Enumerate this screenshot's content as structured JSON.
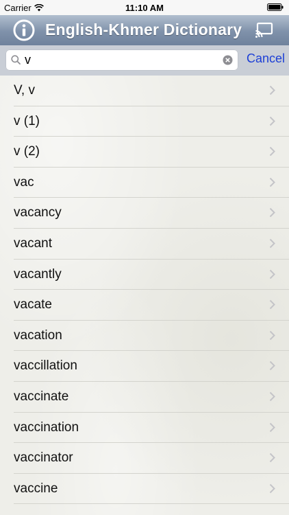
{
  "status_bar": {
    "carrier": "Carrier",
    "time": "11:10 AM",
    "icons": [
      "wifi-icon",
      "battery-icon"
    ]
  },
  "title_bar": {
    "title": "English-Khmer Dictionary",
    "icons": [
      "info-icon",
      "cast-icon"
    ],
    "color": "#7f91aa"
  },
  "search": {
    "value": "v",
    "placeholder": "",
    "cancel_label": "Cancel",
    "cancel_color": "#1c3fd6"
  },
  "words": [
    "V, v",
    "v (1)",
    "v (2)",
    "vac",
    "vacancy",
    "vacant",
    "vacantly",
    "vacate",
    "vacation",
    "vaccillation",
    "vaccinate",
    "vaccination",
    "vaccinator",
    "vaccine"
  ]
}
